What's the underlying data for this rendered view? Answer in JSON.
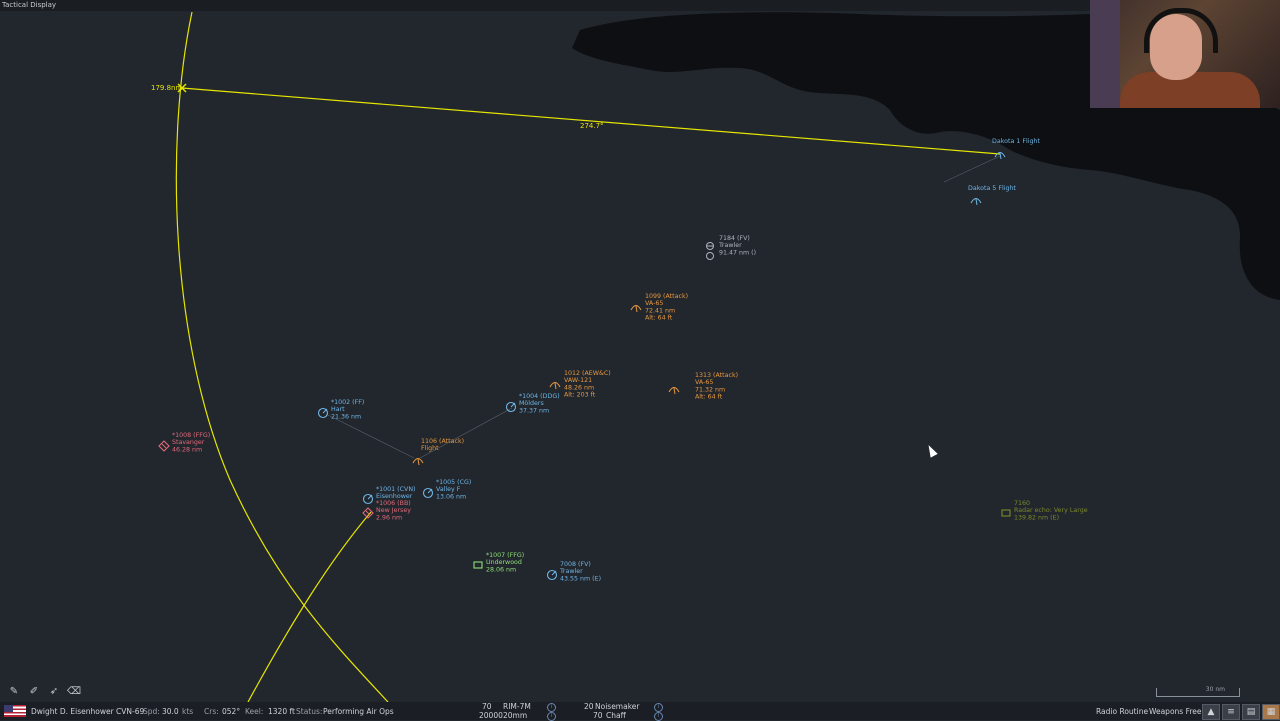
{
  "window": {
    "title": "Tactical Display"
  },
  "measure": {
    "range": "179.8nm",
    "bearing": "274.7°"
  },
  "contacts": [
    {
      "kind": "friendly",
      "lines": [
        "Dakota 1 Flight"
      ]
    },
    {
      "kind": "friendly",
      "lines": [
        "Dakota 5 Flight"
      ]
    },
    {
      "kind": "neutral",
      "lines": [
        "7184 (FV)",
        "Trawler",
        "91.47 nm ()"
      ]
    },
    {
      "kind": "hostile",
      "lines": [
        "1099 (Attack)",
        "VA-65",
        "72.41 nm",
        "Alt: 64 ft"
      ]
    },
    {
      "kind": "hostile",
      "lines": [
        "1012 (AEW&C)",
        "VAW-121",
        "48.26 nm",
        "Alt: 203 ft"
      ]
    },
    {
      "kind": "hostile",
      "lines": [
        "1313 (Attack)",
        "VA-65",
        "71.32 nm",
        "Alt: 64 ft"
      ]
    },
    {
      "kind": "friendly",
      "lines": [
        "*1004 (DDG)",
        "Mölders",
        "37.37 nm"
      ]
    },
    {
      "kind": "friendly",
      "lines": [
        "*1002 (FF)",
        "Hart",
        "21.36 nm"
      ]
    },
    {
      "kind": "danger",
      "lines": [
        "*1008 (FFG)",
        "Stavanger",
        "46.28 nm"
      ]
    },
    {
      "kind": "hostile",
      "lines": [
        "1106 (Attack)",
        "Flight"
      ]
    },
    {
      "kind": "friendly",
      "lines": [
        "*1005 (CG)",
        "Valley F",
        "13.06 nm"
      ]
    },
    {
      "kind": "friendly",
      "lines": [
        "*1001 (CVN)",
        "Eisenhower"
      ]
    },
    {
      "kind": "danger",
      "lines": [
        "*1006 (BB)",
        "New Jersey",
        "2.96 nm"
      ]
    },
    {
      "kind": "ally",
      "lines": [
        "*1007 (FFG)",
        "Underwood",
        "28.06 nm"
      ]
    },
    {
      "kind": "friendly",
      "lines": [
        "7008 (FV)",
        "Trawler",
        "43.55 nm (E)"
      ]
    },
    {
      "kind": "unknown",
      "lines": [
        "7160",
        "Radar echo: Very Large",
        "139.82 nm (E)"
      ]
    }
  ],
  "colors": {
    "background": "#22262d",
    "land": "#0d0f12",
    "measure": "#e6e600",
    "friendly": "#6fb6e6",
    "hostile": "#e7993f",
    "danger": "#e06a7a",
    "ally": "#8fe07a",
    "neutral": "#aeb4bd",
    "unknown": "#7a8a2a"
  },
  "status": {
    "unit": "Dwight D. Eisenhower CVN-69",
    "spd_label": "Spd:",
    "spd_value": "30.0",
    "spd_unit": "kts",
    "crs_label": "Crs:",
    "crs_value": "052°",
    "keel_label": "Keel:",
    "keel_value": "1320 ft",
    "status_label": "Status:",
    "status_value": "Performing Air Ops",
    "weapons": [
      {
        "count": "70",
        "name": "RIM-7M"
      },
      {
        "count": "20000",
        "name": "20mm"
      },
      {
        "count": "20",
        "name": "Noisemaker"
      },
      {
        "count": "70",
        "name": "Chaff"
      }
    ],
    "radio": "Radio Routine",
    "weapons_state": "Weapons Free"
  },
  "scale_label": "30 nm",
  "icons": [
    "pencil-icon",
    "brush-icon",
    "pin-icon",
    "eraser-icon",
    "info-icon",
    "unit-icon",
    "list-icon",
    "panel-icon",
    "grid-icon"
  ]
}
